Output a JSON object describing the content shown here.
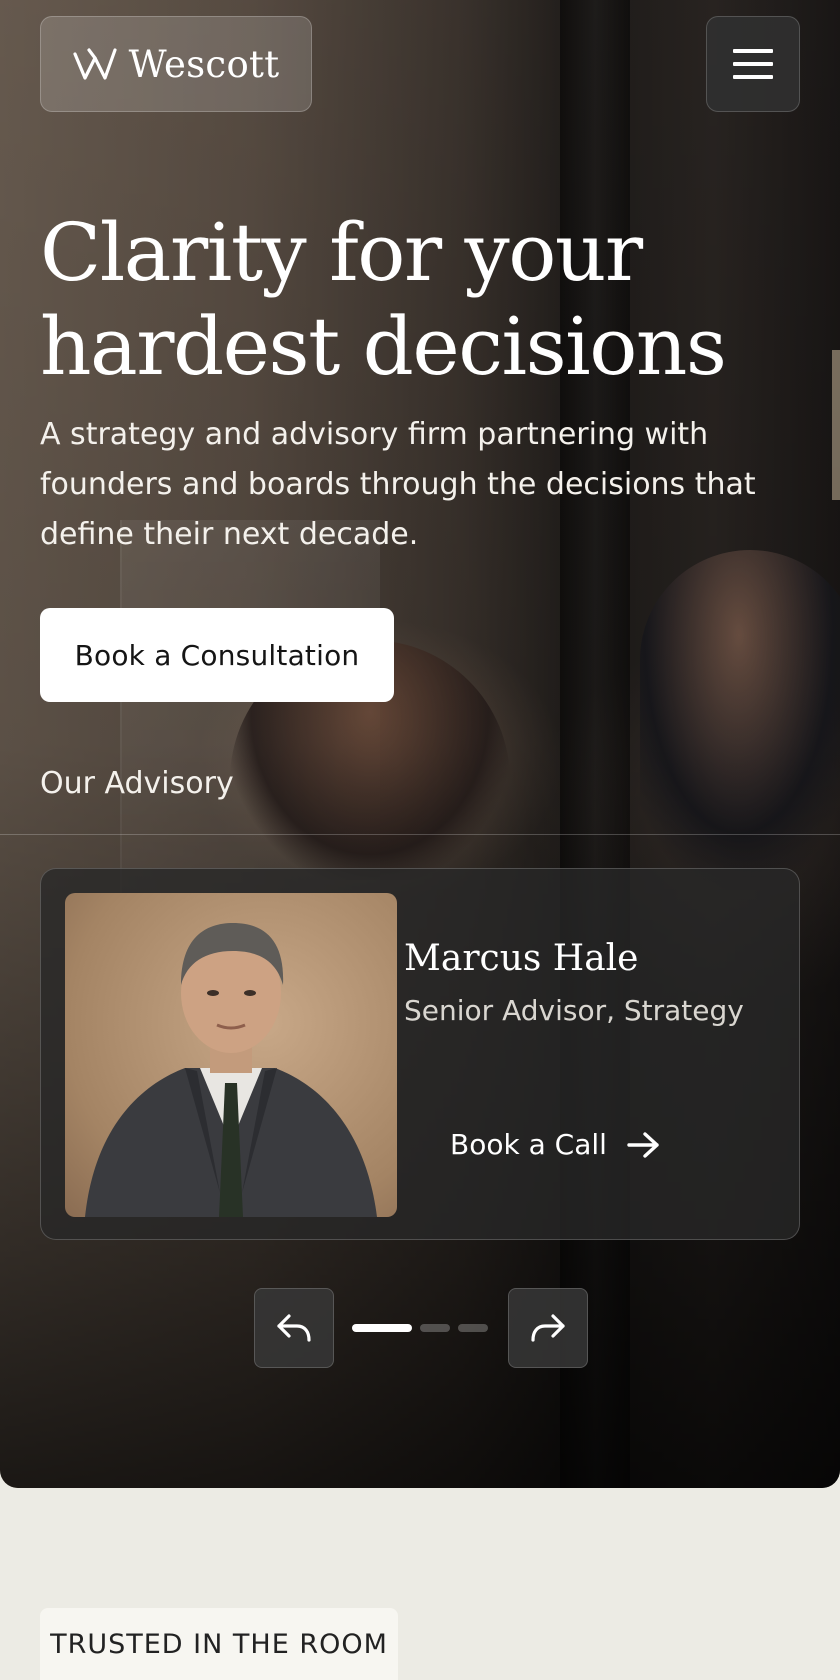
{
  "brand": {
    "name": "Wescott"
  },
  "header": {
    "menu_icon": "hamburger-menu-icon"
  },
  "hero": {
    "headline": "Clarity for your hardest decisions",
    "subtext": "A strategy and advisory firm partnering with founders and boards through the decisions that define their next decade.",
    "cta_label": "Book a Consultation"
  },
  "advisory": {
    "section_label": "Our Advisory",
    "advisors": [
      {
        "name": "Marcus Hale",
        "role": "Senior Advisor, Strategy",
        "action_label": "Book a Call"
      }
    ],
    "carousel": {
      "slides": 3,
      "active_index": 0,
      "prev_icon": "undo-arrow-icon",
      "next_icon": "redo-arrow-icon"
    }
  },
  "trust": {
    "badge_label": "TRUSTED IN THE ROOM"
  }
}
